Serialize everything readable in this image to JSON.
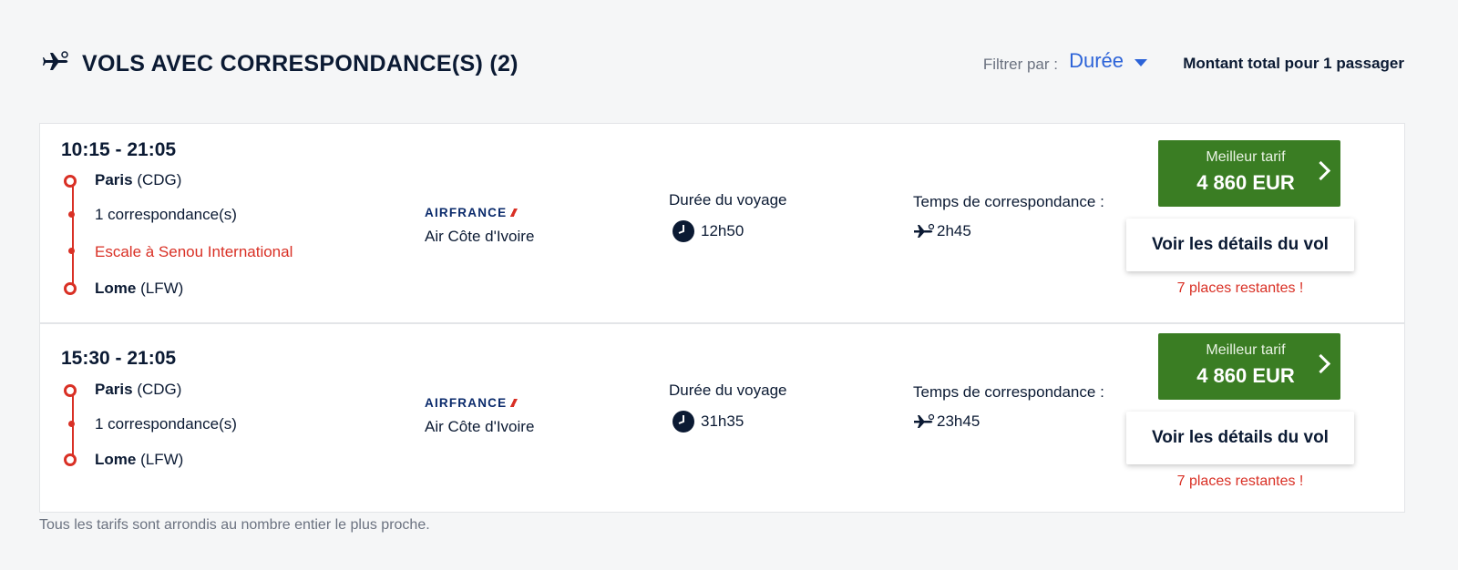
{
  "header": {
    "title": "VOLS AVEC CORRESPONDANCE(S) (2)",
    "title_icon": "connecting-flight-icon",
    "filter_label": "Filtrer par :",
    "filter_value": "Durée",
    "total_label": "Montant total pour 1 passager"
  },
  "colors": {
    "accent_red": "#d93025",
    "price_green": "#3a7d23",
    "link_blue": "#2c63d8",
    "navy": "#0b1a33"
  },
  "flights": [
    {
      "times": "10:15 - 21:05",
      "origin_city": "Paris",
      "origin_code": "(CDG)",
      "connections": "1 correspondance(s)",
      "stopover": "Escale à Senou International",
      "dest_city": "Lome",
      "dest_code": "(LFW)",
      "airline_logo": "AIRFRANCE",
      "airline_name": "Air Côte d'Ivoire",
      "duration_label": "Durée du voyage",
      "duration": "12h50",
      "connection_time_label": "Temps de correspondance :",
      "connection_time": "2h45",
      "price_label": "Meilleur tarif",
      "price": "4 860 EUR",
      "details_label": "Voir les détails du vol",
      "seats_left": "7 places restantes !"
    },
    {
      "times": "15:30 - 21:05",
      "origin_city": "Paris",
      "origin_code": "(CDG)",
      "connections": "1 correspondance(s)",
      "dest_city": "Lome",
      "dest_code": "(LFW)",
      "airline_logo": "AIRFRANCE",
      "airline_name": "Air Côte d'Ivoire",
      "duration_label": "Durée du voyage",
      "duration": "31h35",
      "connection_time_label": "Temps de correspondance :",
      "connection_time": "23h45",
      "price_label": "Meilleur tarif",
      "price": "4 860 EUR",
      "details_label": "Voir les détails du vol",
      "seats_left": "7 places restantes !"
    }
  ],
  "footnote": "Tous les tarifs sont arrondis au nombre entier le plus proche."
}
